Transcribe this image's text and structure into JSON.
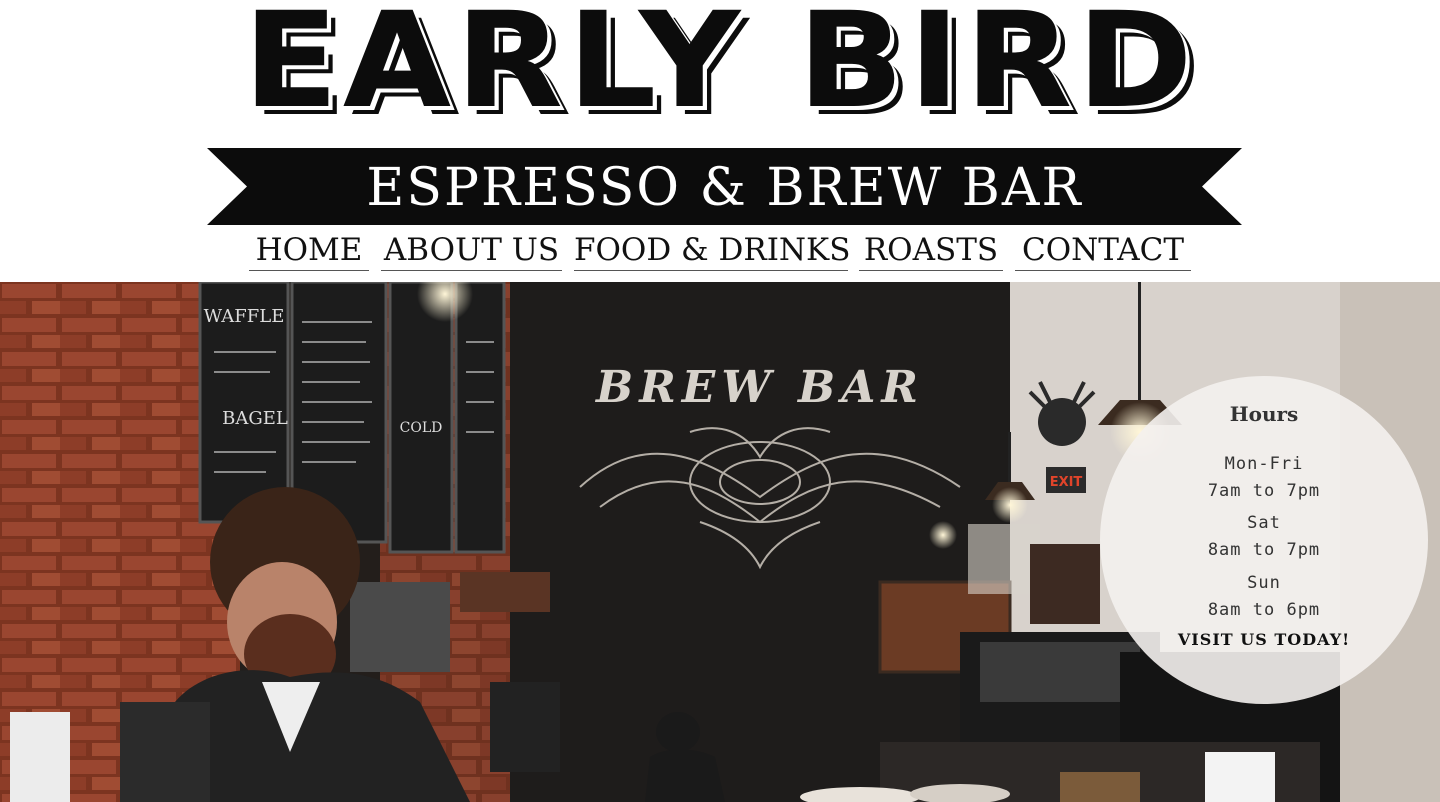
{
  "brand": {
    "logo": "EARLY BIRD",
    "tagline": "ESPRESSO & BREW BAR"
  },
  "nav": {
    "items": [
      {
        "label": "HOME"
      },
      {
        "label": "ABOUT US"
      },
      {
        "label": "FOOD & DRINKS"
      },
      {
        "label": "ROASTS"
      },
      {
        "label": "CONTACT"
      }
    ]
  },
  "hero": {
    "sign": "BREW BAR",
    "exit_sign": "EXIT",
    "menu_board_lines": [
      "WAFFLE",
      "BAGEL",
      "COLD"
    ]
  },
  "hours": {
    "title": "Hours",
    "weekday_label": "Mon-Fri",
    "weekday_time": "7am to 7pm",
    "sat_label": "Sat",
    "sat_time": "8am to 7pm",
    "sun_label": "Sun",
    "sun_time": "8am to 6pm",
    "cta": "VISIT US TODAY!"
  },
  "colors": {
    "ink": "#0c0c0c",
    "background": "#ffffff",
    "brick": "#8a3a24",
    "chalkboard": "#1f1d1c"
  }
}
